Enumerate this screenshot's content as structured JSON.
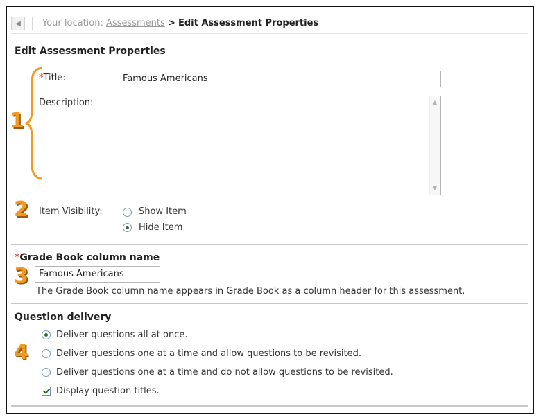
{
  "breadcrumb": {
    "prefix": "Your location:",
    "link": "Assessments",
    "separator": ">",
    "current": "Edit Assessment Properties"
  },
  "properties": {
    "heading": "Edit Assessment Properties",
    "required_mark": "*",
    "title_label": "Title:",
    "title_value": "Famous Americans",
    "description_label": "Description:",
    "description_value": "",
    "visibility_label": "Item Visibility:",
    "visibility_options": [
      {
        "label": "Show Item",
        "checked": false
      },
      {
        "label": "Hide Item",
        "checked": true
      }
    ]
  },
  "gradebook": {
    "required_mark": "*",
    "heading": "Grade Book column name",
    "column_value": "Famous Americans",
    "help_text": "The Grade Book column name appears in Grade Book as a column header for this assessment."
  },
  "delivery": {
    "heading": "Question delivery",
    "options": [
      {
        "label": "Deliver questions all at once.",
        "checked": true
      },
      {
        "label": "Deliver questions one at a time and allow questions to be revisited.",
        "checked": false
      },
      {
        "label": "Deliver questions one at a time and do not allow questions to be revisited.",
        "checked": false
      }
    ],
    "display_titles_label": "Display question titles.",
    "display_titles_checked": true
  },
  "annotations": {
    "callouts": [
      "1",
      "2",
      "3",
      "4"
    ],
    "callout_color": "#f29a1f"
  }
}
